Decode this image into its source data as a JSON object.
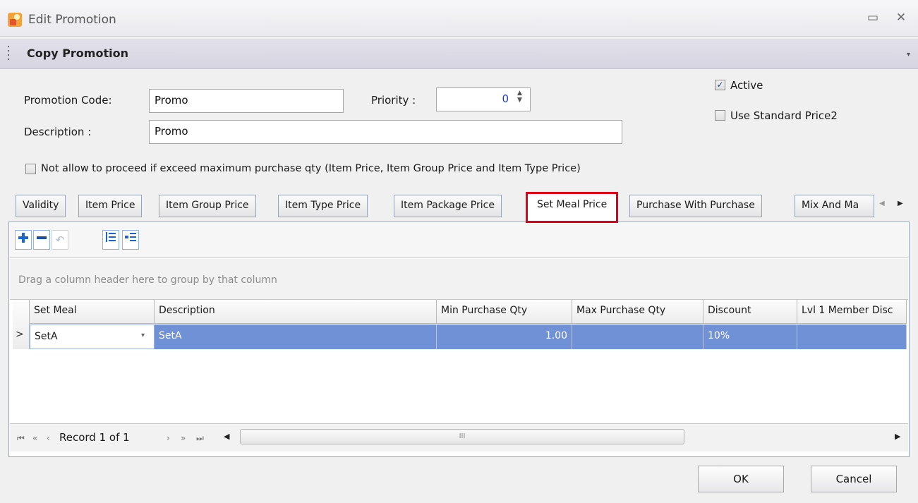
{
  "window": {
    "title": "Edit Promotion",
    "icon": "app-icon",
    "minimize_glyph": "▭",
    "close_glyph": "✕"
  },
  "ribbon": {
    "copy_label": "Copy Promotion",
    "expand_icon": "chevron-down-icon"
  },
  "form": {
    "promotion_code_label": "Promotion Code:",
    "promotion_code_value": "Promo",
    "priority_label": "Priority :",
    "priority_value": "0",
    "description_label": "Description :",
    "description_value": "Promo",
    "active_label": "Active",
    "active_checked": true,
    "use_standard_price2_label": "Use Standard Price2",
    "use_standard_price2_checked": false,
    "not_allow_label": "Not allow to proceed if exceed maximum purchase qty (Item Price, Item Group Price and Item Type Price)",
    "not_allow_checked": false
  },
  "tabs": [
    {
      "label": "Validity"
    },
    {
      "label": "Item Price"
    },
    {
      "label": "Item Group Price"
    },
    {
      "label": "Item Type Price"
    },
    {
      "label": "Item Package Price"
    },
    {
      "label": "Set Meal Price",
      "active": true
    },
    {
      "label": "Purchase With Purchase"
    },
    {
      "label": "Mix And Ma"
    }
  ],
  "toolbar": {
    "icons": [
      "add-icon",
      "remove-icon",
      "undo-icon",
      "expand-rows-icon",
      "collapse-rows-icon"
    ]
  },
  "grid": {
    "group_hint": "Drag a column header here to group by that column",
    "columns": [
      "Set Meal",
      "Description",
      "Min Purchase Qty",
      "Max Purchase Qty",
      "Discount",
      "Lvl 1 Member Disc"
    ],
    "rows": [
      {
        "set_meal": "SetA",
        "description": "SetA",
        "min_qty": "1.00",
        "max_qty": "",
        "discount": "10%",
        "lvl1": ""
      }
    ]
  },
  "navigator": {
    "record_text": "Record 1 of 1",
    "scroll_grip": "III"
  },
  "buttons": {
    "ok": "OK",
    "cancel": "Cancel"
  },
  "colors": {
    "selection": "#7191d6",
    "active_tab_outline": "#e0001a",
    "priority_value": "#1a3cd0"
  }
}
